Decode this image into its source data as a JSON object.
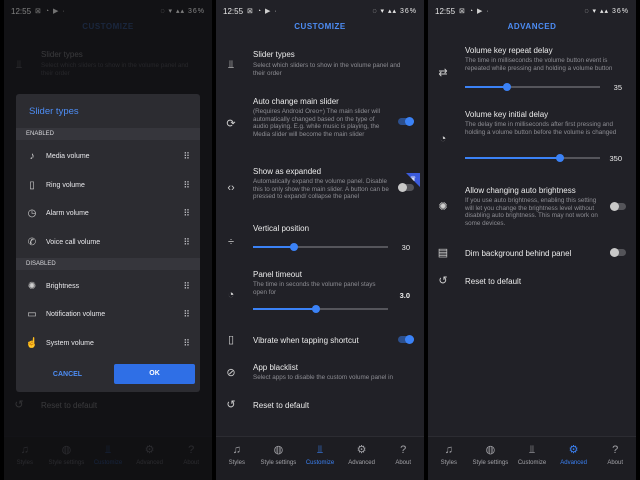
{
  "status": {
    "time": "12:55",
    "battery": "36%",
    "left_icons": "⊠ ◔ ▶ ·",
    "right_icons": "◌ ▾ ▴▴"
  },
  "nav": [
    {
      "label": "Styles",
      "icon": "bell-icon"
    },
    {
      "label": "Style settings",
      "icon": "palette-icon"
    },
    {
      "label": "Customize",
      "icon": "tune-icon"
    },
    {
      "label": "Advanced",
      "icon": "gear-icon"
    },
    {
      "label": "About",
      "icon": "help-icon"
    }
  ],
  "accent_color": "#3b82f6",
  "screen1": {
    "title": "CUSTOMIZE",
    "background": {
      "slider_types_title": "Slider types",
      "slider_types_desc": "Select which sliders to show in the volume panel and their order",
      "reset": "Reset to default"
    },
    "dialog": {
      "title": "Slider types",
      "enabled_header": "ENABLED",
      "disabled_header": "DISABLED",
      "enabled": [
        {
          "label": "Media volume",
          "icon": "music-note-icon"
        },
        {
          "label": "Ring volume",
          "icon": "vibrate-icon"
        },
        {
          "label": "Alarm volume",
          "icon": "alarm-icon"
        },
        {
          "label": "Voice call volume",
          "icon": "phone-icon"
        }
      ],
      "disabled": [
        {
          "label": "Brightness",
          "icon": "brightness-icon"
        },
        {
          "label": "Notification volume",
          "icon": "message-icon"
        },
        {
          "label": "System volume",
          "icon": "hand-icon"
        }
      ],
      "cancel": "CANCEL",
      "ok": "OK"
    }
  },
  "screen2": {
    "title": "CUSTOMIZE",
    "slider_types": {
      "title": "Slider types",
      "desc": "Select which sliders to show in the volume panel and their order"
    },
    "auto_change": {
      "title": "Auto change main slider",
      "desc": "(Requires Android Oreo+) The main slider will automatically changed based on the type of audio playing. E.g. while music is playing, the Media slider will become the main slider",
      "on": true
    },
    "show_expanded": {
      "title": "Show as expanded",
      "desc": "Automatically expand the volume panel. Disable this to only show the main slider. A button can be pressed to expand/ collapse the panel",
      "on": false
    },
    "vertical_position": {
      "title": "Vertical position",
      "value": 30,
      "display": "30",
      "fraction": 0.3
    },
    "panel_timeout": {
      "title": "Panel timeout",
      "desc": "The time in seconds the volume panel stays open for",
      "value": 3.0,
      "display": "3.0",
      "fraction": 0.47
    },
    "vibrate": {
      "title": "Vibrate when tapping shortcut",
      "on": true
    },
    "app_blacklist": {
      "title": "App blacklist",
      "desc": "Select apps to disable the custom volume panel in"
    },
    "reset": "Reset to default"
  },
  "screen3": {
    "title": "ADVANCED",
    "repeat_delay": {
      "title": "Volume key repeat delay",
      "desc": "The time in milliseconds the volume button event is repeated while pressing and holding a volume button",
      "value": 35,
      "display": "35",
      "fraction": 0.31
    },
    "initial_delay": {
      "title": "Volume key initial delay",
      "desc": "The delay time in milliseconds after first pressing and holding a volume button before the volume is changed",
      "value": 350,
      "display": "350",
      "fraction": 0.7
    },
    "auto_brightness": {
      "title": "Allow changing auto brightness",
      "desc": "If you use auto brightness, enabling this setting will let you change the brightness level without disabling auto brightness. This may not work on some devices.",
      "on": false
    },
    "dim_background": {
      "title": "Dim background behind panel",
      "on": false
    },
    "reset": "Reset to default"
  }
}
